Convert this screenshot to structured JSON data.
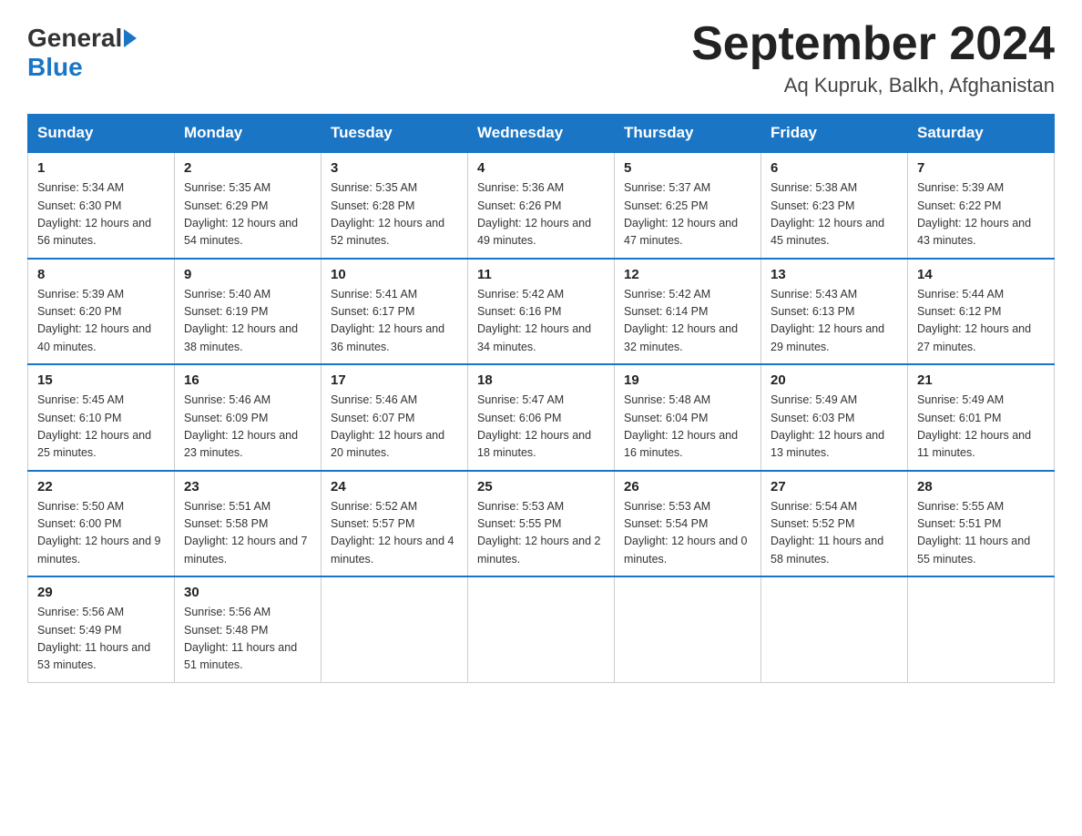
{
  "logo": {
    "general": "General",
    "blue": "Blue"
  },
  "title": "September 2024",
  "subtitle": "Aq Kupruk, Balkh, Afghanistan",
  "weekdays": [
    "Sunday",
    "Monday",
    "Tuesday",
    "Wednesday",
    "Thursday",
    "Friday",
    "Saturday"
  ],
  "weeks": [
    [
      {
        "day": "1",
        "sunrise": "5:34 AM",
        "sunset": "6:30 PM",
        "daylight": "12 hours and 56 minutes."
      },
      {
        "day": "2",
        "sunrise": "5:35 AM",
        "sunset": "6:29 PM",
        "daylight": "12 hours and 54 minutes."
      },
      {
        "day": "3",
        "sunrise": "5:35 AM",
        "sunset": "6:28 PM",
        "daylight": "12 hours and 52 minutes."
      },
      {
        "day": "4",
        "sunrise": "5:36 AM",
        "sunset": "6:26 PM",
        "daylight": "12 hours and 49 minutes."
      },
      {
        "day": "5",
        "sunrise": "5:37 AM",
        "sunset": "6:25 PM",
        "daylight": "12 hours and 47 minutes."
      },
      {
        "day": "6",
        "sunrise": "5:38 AM",
        "sunset": "6:23 PM",
        "daylight": "12 hours and 45 minutes."
      },
      {
        "day": "7",
        "sunrise": "5:39 AM",
        "sunset": "6:22 PM",
        "daylight": "12 hours and 43 minutes."
      }
    ],
    [
      {
        "day": "8",
        "sunrise": "5:39 AM",
        "sunset": "6:20 PM",
        "daylight": "12 hours and 40 minutes."
      },
      {
        "day": "9",
        "sunrise": "5:40 AM",
        "sunset": "6:19 PM",
        "daylight": "12 hours and 38 minutes."
      },
      {
        "day": "10",
        "sunrise": "5:41 AM",
        "sunset": "6:17 PM",
        "daylight": "12 hours and 36 minutes."
      },
      {
        "day": "11",
        "sunrise": "5:42 AM",
        "sunset": "6:16 PM",
        "daylight": "12 hours and 34 minutes."
      },
      {
        "day": "12",
        "sunrise": "5:42 AM",
        "sunset": "6:14 PM",
        "daylight": "12 hours and 32 minutes."
      },
      {
        "day": "13",
        "sunrise": "5:43 AM",
        "sunset": "6:13 PM",
        "daylight": "12 hours and 29 minutes."
      },
      {
        "day": "14",
        "sunrise": "5:44 AM",
        "sunset": "6:12 PM",
        "daylight": "12 hours and 27 minutes."
      }
    ],
    [
      {
        "day": "15",
        "sunrise": "5:45 AM",
        "sunset": "6:10 PM",
        "daylight": "12 hours and 25 minutes."
      },
      {
        "day": "16",
        "sunrise": "5:46 AM",
        "sunset": "6:09 PM",
        "daylight": "12 hours and 23 minutes."
      },
      {
        "day": "17",
        "sunrise": "5:46 AM",
        "sunset": "6:07 PM",
        "daylight": "12 hours and 20 minutes."
      },
      {
        "day": "18",
        "sunrise": "5:47 AM",
        "sunset": "6:06 PM",
        "daylight": "12 hours and 18 minutes."
      },
      {
        "day": "19",
        "sunrise": "5:48 AM",
        "sunset": "6:04 PM",
        "daylight": "12 hours and 16 minutes."
      },
      {
        "day": "20",
        "sunrise": "5:49 AM",
        "sunset": "6:03 PM",
        "daylight": "12 hours and 13 minutes."
      },
      {
        "day": "21",
        "sunrise": "5:49 AM",
        "sunset": "6:01 PM",
        "daylight": "12 hours and 11 minutes."
      }
    ],
    [
      {
        "day": "22",
        "sunrise": "5:50 AM",
        "sunset": "6:00 PM",
        "daylight": "12 hours and 9 minutes."
      },
      {
        "day": "23",
        "sunrise": "5:51 AM",
        "sunset": "5:58 PM",
        "daylight": "12 hours and 7 minutes."
      },
      {
        "day": "24",
        "sunrise": "5:52 AM",
        "sunset": "5:57 PM",
        "daylight": "12 hours and 4 minutes."
      },
      {
        "day": "25",
        "sunrise": "5:53 AM",
        "sunset": "5:55 PM",
        "daylight": "12 hours and 2 minutes."
      },
      {
        "day": "26",
        "sunrise": "5:53 AM",
        "sunset": "5:54 PM",
        "daylight": "12 hours and 0 minutes."
      },
      {
        "day": "27",
        "sunrise": "5:54 AM",
        "sunset": "5:52 PM",
        "daylight": "11 hours and 58 minutes."
      },
      {
        "day": "28",
        "sunrise": "5:55 AM",
        "sunset": "5:51 PM",
        "daylight": "11 hours and 55 minutes."
      }
    ],
    [
      {
        "day": "29",
        "sunrise": "5:56 AM",
        "sunset": "5:49 PM",
        "daylight": "11 hours and 53 minutes."
      },
      {
        "day": "30",
        "sunrise": "5:56 AM",
        "sunset": "5:48 PM",
        "daylight": "11 hours and 51 minutes."
      },
      null,
      null,
      null,
      null,
      null
    ]
  ]
}
